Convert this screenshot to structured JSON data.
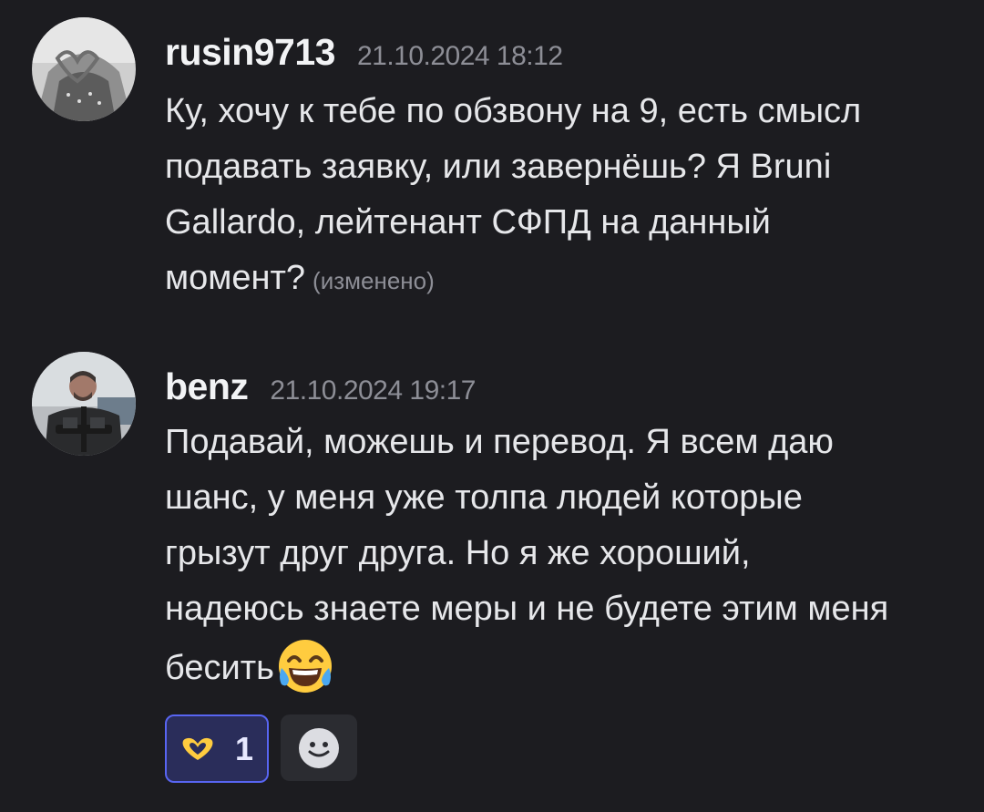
{
  "messages": [
    {
      "author": "rusin9713",
      "timestamp": "21.10.2024 18:12",
      "lines": [
        "Ку, хочу к тебе по обзвону на 9, есть смысл",
        "подавать заявку, или завернёшь? Я Bruni",
        "Gallardo, лейтенант СФПД на данный",
        "момент?"
      ],
      "edited_label": "(изменено)"
    },
    {
      "author": "benz",
      "timestamp": "21.10.2024 19:17",
      "lines": [
        "Подавай, можешь и перевод. Я всем даю",
        "шанс, у меня уже толпа людей которые",
        "грызут друг друга. Но я же хороший,",
        "надеюсь знаете меры и не будете этим меня",
        "бесить"
      ],
      "trailing_emoji": "face-with-tears-of-joy",
      "reactions": [
        {
          "emoji": "heart-hands",
          "count": "1",
          "active": true
        }
      ]
    }
  ],
  "colors": {
    "background": "#1c1c20",
    "reaction_active_border": "#5865f2",
    "reaction_active_bg": "#2a2d5a",
    "timestamp": "#8d8e96"
  }
}
